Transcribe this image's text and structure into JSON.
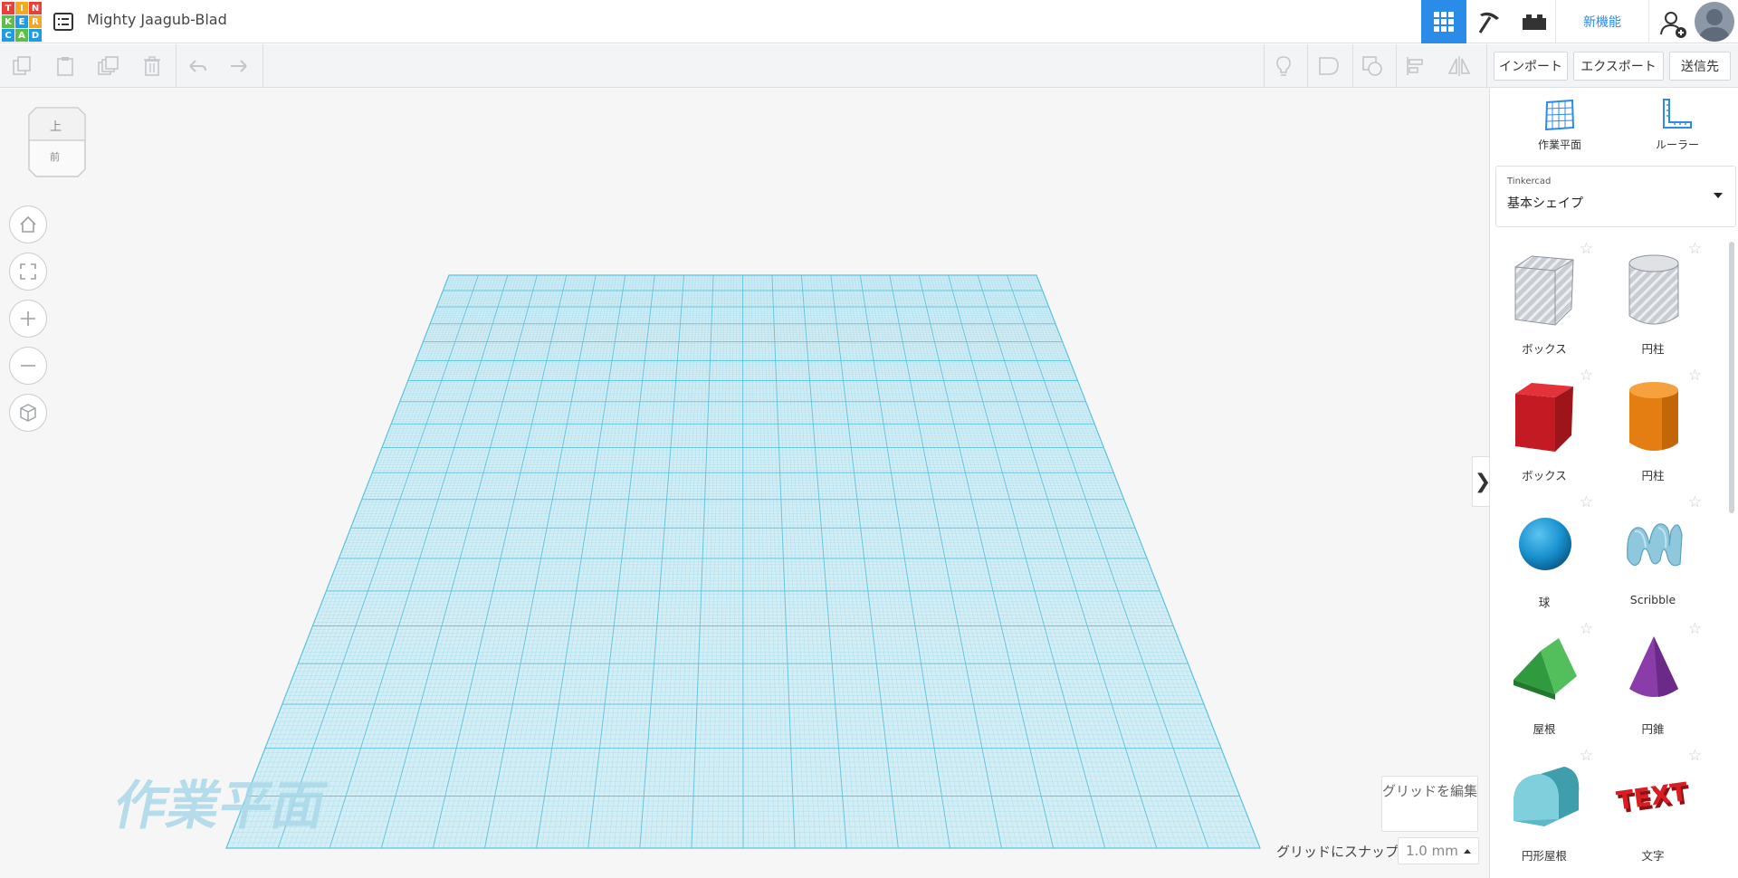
{
  "app": {
    "logo_letters": [
      "T",
      "I",
      "N",
      "K",
      "E",
      "R",
      "C",
      "A",
      "D"
    ],
    "design_title": "Mighty Jaagub-Blad",
    "new_features": "新機能"
  },
  "top_icons": {
    "designs": "list-icon",
    "view_3d": "grid-view-icon",
    "view_build": "pickaxe-icon",
    "view_bricks": "brick-icon",
    "invite": "add-user-icon",
    "avatar": "user-avatar"
  },
  "toolbar": {
    "import_label": "インポート",
    "export_label": "エクスポート",
    "send_label": "送信先",
    "left_icons": [
      "copy-icon",
      "paste-icon",
      "duplicate-icon",
      "delete-icon",
      "undo-icon",
      "redo-icon"
    ],
    "right_icons": [
      "light-bulb-icon",
      "shape-solid-icon",
      "shape-hole-icon",
      "align-icon",
      "mirror-icon"
    ]
  },
  "viewcube": {
    "top_label": "上",
    "front_label": "前"
  },
  "canvas": {
    "workplane_watermark": "作業平面",
    "edit_grid_label": "グリッドを編集",
    "snap_label": "グリッドにスナップ",
    "snap_value": "1.0 mm",
    "nav_icons": [
      "home-icon",
      "fit-icon",
      "zoom-in-icon",
      "zoom-out-icon",
      "perspective-icon"
    ]
  },
  "panel": {
    "workplane_label": "作業平面",
    "ruler_label": "ルーラー",
    "library_category": "Tinkercad",
    "library_name": "基本シェイプ",
    "shapes": [
      {
        "name": "ボックス",
        "kind": "box-hole"
      },
      {
        "name": "円柱",
        "kind": "cylinder-hole"
      },
      {
        "name": "ボックス",
        "kind": "box"
      },
      {
        "name": "円柱",
        "kind": "cylinder"
      },
      {
        "name": "球",
        "kind": "sphere"
      },
      {
        "name": "Scribble",
        "kind": "scribble"
      },
      {
        "name": "屋根",
        "kind": "roof"
      },
      {
        "name": "円錐",
        "kind": "cone"
      },
      {
        "name": "円形屋根",
        "kind": "round-roof"
      },
      {
        "name": "文字",
        "kind": "text"
      }
    ]
  },
  "colors": {
    "accent": "#2a8be8",
    "grid_line": "#5cc0dd",
    "grid_fill": "#d4eef6",
    "box_red": "#d8202a",
    "cylinder_orange": "#f08a1c",
    "sphere_blue": "#1a9bd7",
    "roof_green": "#3aa845",
    "cone_purple": "#8a3fa8",
    "round_roof_teal": "#66c3cf",
    "text_red": "#c4171c"
  }
}
